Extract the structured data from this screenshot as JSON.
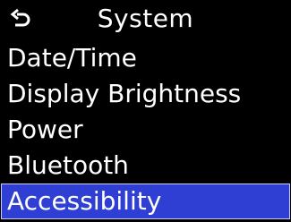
{
  "header": {
    "title": "System",
    "back_icon": "return-arrow-icon"
  },
  "menu": {
    "items": [
      {
        "label": "Date/Time"
      },
      {
        "label": "Display Brightness"
      },
      {
        "label": "Power"
      },
      {
        "label": "Bluetooth"
      },
      {
        "label": "Accessibility",
        "selected": true
      }
    ]
  },
  "colors": {
    "background": "#000000",
    "text": "#ffffff",
    "selection": "#2f3fd4"
  }
}
